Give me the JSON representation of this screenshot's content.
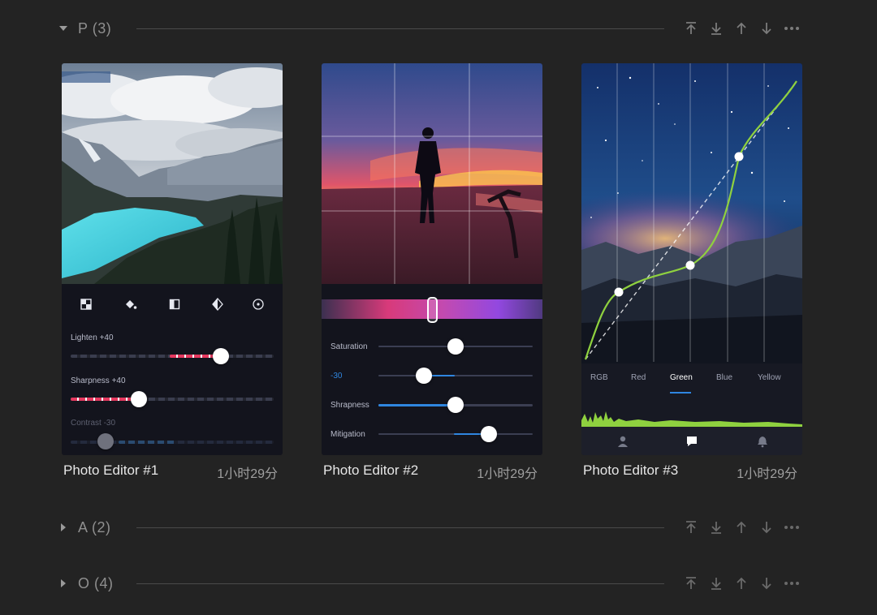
{
  "sections": [
    {
      "title": "P",
      "count": "(3)",
      "expanded": true
    },
    {
      "title": "A",
      "count": "(2)",
      "expanded": false
    },
    {
      "title": "O",
      "count": "(4)",
      "expanded": false
    }
  ],
  "cards": [
    {
      "name": "Photo Editor #1",
      "time": "1小时29分",
      "sliders": [
        {
          "label": "Lighten +40",
          "value": 0.75
        },
        {
          "label": "Sharpness +40",
          "value": 0.34
        },
        {
          "label": "Contrast -30",
          "value": 0.18
        }
      ],
      "tools": [
        "grid-icon",
        "fill-bucket-icon",
        "split-view-icon",
        "contrast-icon",
        "radial-icon"
      ]
    },
    {
      "name": "Photo Editor #2",
      "time": "1小时29分",
      "hue_value": 0.5,
      "sliders": [
        {
          "label": "Saturation",
          "value": 0.5
        },
        {
          "label": "-30",
          "value": 0.3
        },
        {
          "label": "Shrapness",
          "value": 0.5
        },
        {
          "label": "Mitigation",
          "value": 0.72
        }
      ]
    },
    {
      "name": "Photo Editor #3",
      "time": "1小时29分",
      "channels": [
        "RGB",
        "Red",
        "Green",
        "Blue",
        "Yellow"
      ],
      "active_channel": "Green",
      "curve_color": "#8fd13f",
      "bottom_icons": [
        "person-icon",
        "chat-icon",
        "bell-icon"
      ]
    }
  ],
  "colors": {
    "accent_pink": "#e5395f",
    "accent_blue": "#2f86e0",
    "curve_green": "#8fd13f"
  }
}
